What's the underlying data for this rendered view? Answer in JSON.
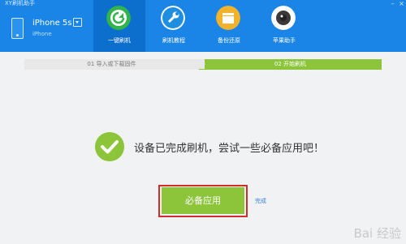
{
  "app": {
    "title": "XY刷机助手"
  },
  "device": {
    "name": "iPhone 5s",
    "model": "iPhone"
  },
  "tabs": [
    {
      "label": "一键刷机",
      "active": true,
      "icon": "refresh-icon",
      "color": "#31b44b"
    },
    {
      "label": "刷机教程",
      "active": false,
      "icon": "wrench-icon",
      "color": "#1e8fe0"
    },
    {
      "label": "备份还原",
      "active": false,
      "icon": "backup-icon",
      "color": "#f2b22b"
    },
    {
      "label": "苹果助手",
      "active": false,
      "icon": "camera-icon",
      "color": "#ffffff"
    }
  ],
  "steps": {
    "step1": "01 导入或下载固件",
    "step2": "02 开始刷机"
  },
  "main": {
    "message": "设备已完成刷机，尝试一些必备应用吧！",
    "primary_button": "必备应用",
    "done_link": "完成"
  },
  "watermark": "Bai 经验",
  "colors": {
    "header": "#1a85e6",
    "accent_green": "#8cc43a",
    "highlight_red": "#d22b2b"
  }
}
